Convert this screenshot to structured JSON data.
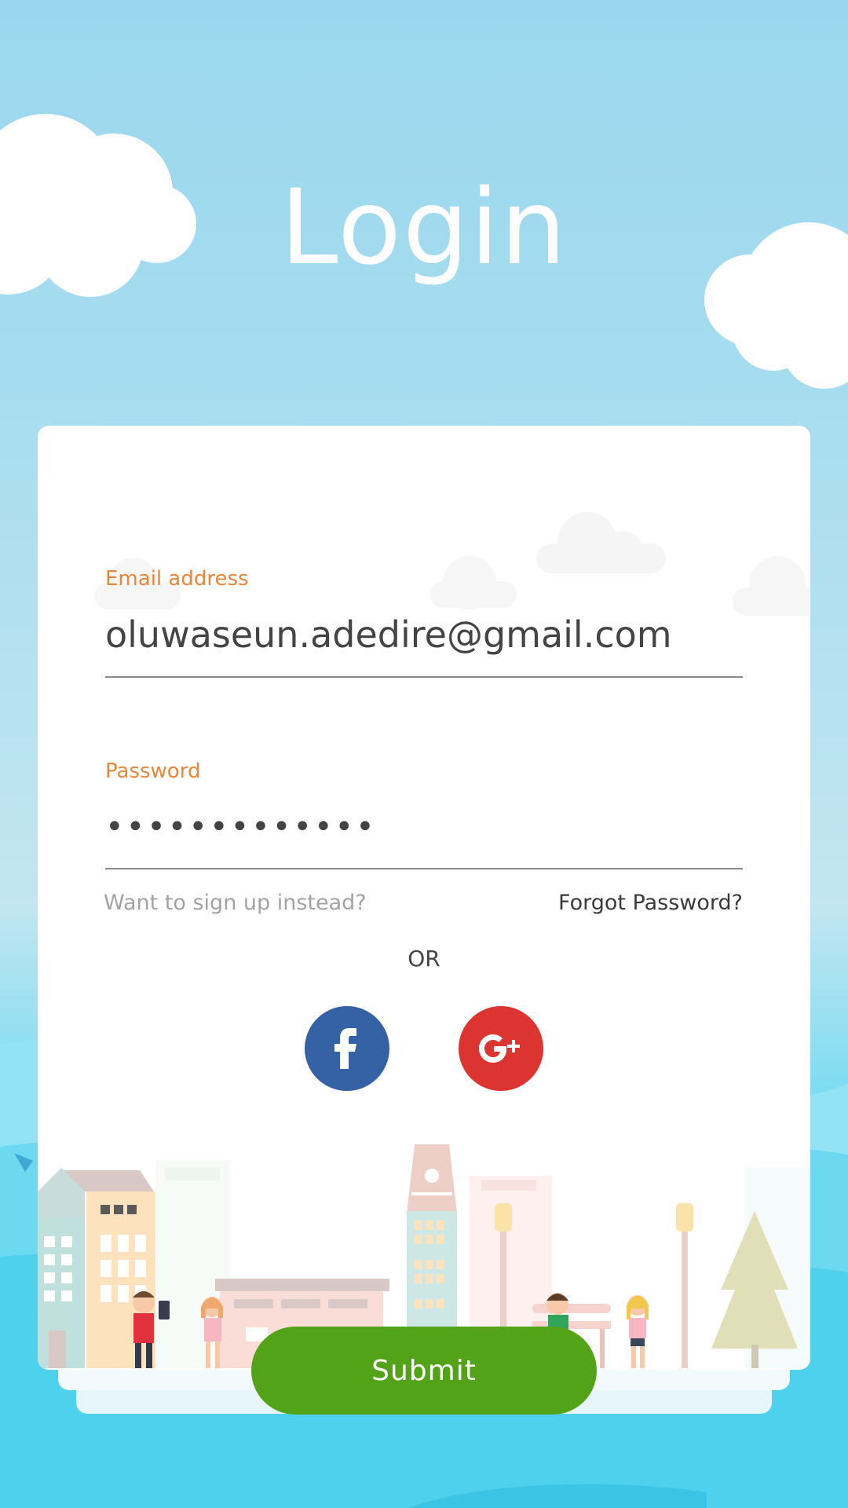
{
  "screen": {
    "title": "Login"
  },
  "form": {
    "email_label": "Email address",
    "email_value": "oluwaseun.adedire@gmail.com",
    "password_label": "Password",
    "password_value": "•••••••••••••",
    "signup_link": "Want to sign up instead?",
    "forgot_link": "Forgot Password?",
    "or_text": "OR",
    "submit_label": "Submit"
  },
  "social": {
    "facebook_icon": "facebook-icon",
    "google_icon": "google-plus-icon"
  },
  "colors": {
    "label": "#e8873a",
    "facebook": "#3562a4",
    "google": "#dc3430",
    "submit": "#53a318",
    "sky": "#9ad7ee"
  }
}
